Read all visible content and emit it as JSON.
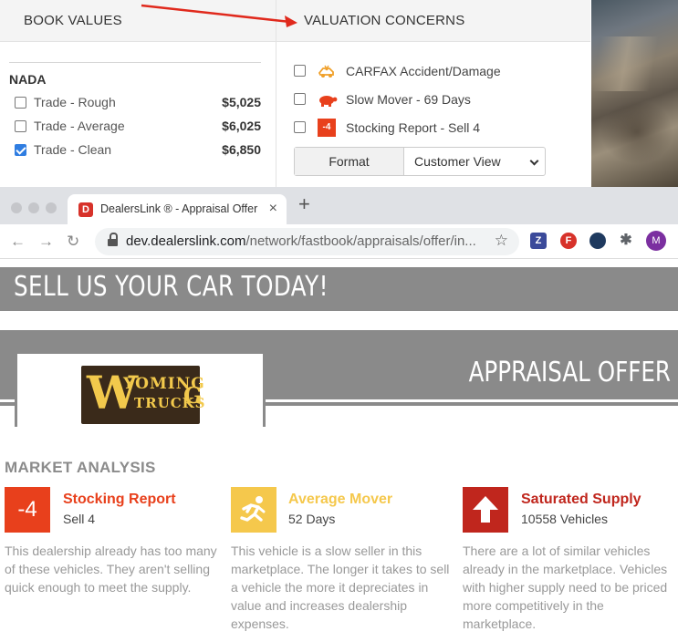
{
  "book_values": {
    "header": "BOOK VALUES",
    "section": "NADA",
    "rows": [
      {
        "label": "Trade - Rough",
        "value": "$5,025",
        "checked": false
      },
      {
        "label": "Trade - Average",
        "value": "$6,025",
        "checked": false
      },
      {
        "label": "Trade - Clean",
        "value": "$6,850",
        "checked": true
      }
    ]
  },
  "valuation_concerns": {
    "header": "VALUATION CONCERNS",
    "items": [
      {
        "label": "CARFAX Accident/Damage",
        "icon": "carfax-icon"
      },
      {
        "label": "Slow Mover - 69 Days",
        "icon": "turtle-icon"
      },
      {
        "label": "Stocking Report - Sell 4",
        "icon": "stocking-report-icon",
        "icon_text": "-4"
      }
    ],
    "format_button": "Format",
    "format_select": "Customer View"
  },
  "browser": {
    "tab_title": "DealersLink ® - Appraisal Offer",
    "favicon_letter": "D",
    "close_glyph": "×",
    "new_tab_glyph": "+",
    "url_host": "dev.dealerslink.com",
    "url_path": "/network/fastbook/appraisals/offer/in...",
    "extensions": [
      {
        "name": "z-extension-icon",
        "text": "Z",
        "color": "#3b4a9a"
      },
      {
        "name": "f-extension-icon",
        "text": "F",
        "color": "#d7322a"
      },
      {
        "name": "circle-extension-icon",
        "text": "",
        "color": "#1f3a5f"
      },
      {
        "name": "puzzle-extension-icon",
        "text": "✱",
        "color": "#5f6368"
      },
      {
        "name": "profile-avatar",
        "text": "M",
        "color": "#7b2fa0"
      }
    ]
  },
  "page": {
    "hero": "SELL US YOUR CAR TODAY!",
    "offer_title": "APPRAISAL OFFER",
    "logo": {
      "big": "W",
      "line1": "YOMING",
      "line2": "TRUCKS",
      "small_g": "G"
    },
    "market_analysis_title": "MARKET ANALYSIS",
    "metrics": [
      {
        "icon_text": "-4",
        "title": "Stocking Report",
        "subtitle": "Sell 4",
        "description_lines": [
          "This dealership already has too many",
          "of these vehicles. They aren't selling",
          "quick enough to meet the supply."
        ],
        "color": "#e8401c"
      },
      {
        "icon_text": "",
        "title": "Average Mover",
        "subtitle": "52 Days",
        "description_lines": [
          "This vehicle is a slow seller in this",
          "marketplace. The longer it takes to sell",
          "a vehicle the more it depreciates in",
          "value and increases dealership",
          "expenses."
        ],
        "color": "#f5c84c"
      },
      {
        "icon_text": "",
        "title": "Saturated Supply",
        "subtitle": "10558 Vehicles",
        "description_lines": [
          "There are a lot of similar vehicles",
          "already in the marketplace. Vehicles",
          "with higher supply need to be priced",
          "more competitively in the",
          "marketplace."
        ],
        "color": "#c0261d"
      }
    ]
  }
}
